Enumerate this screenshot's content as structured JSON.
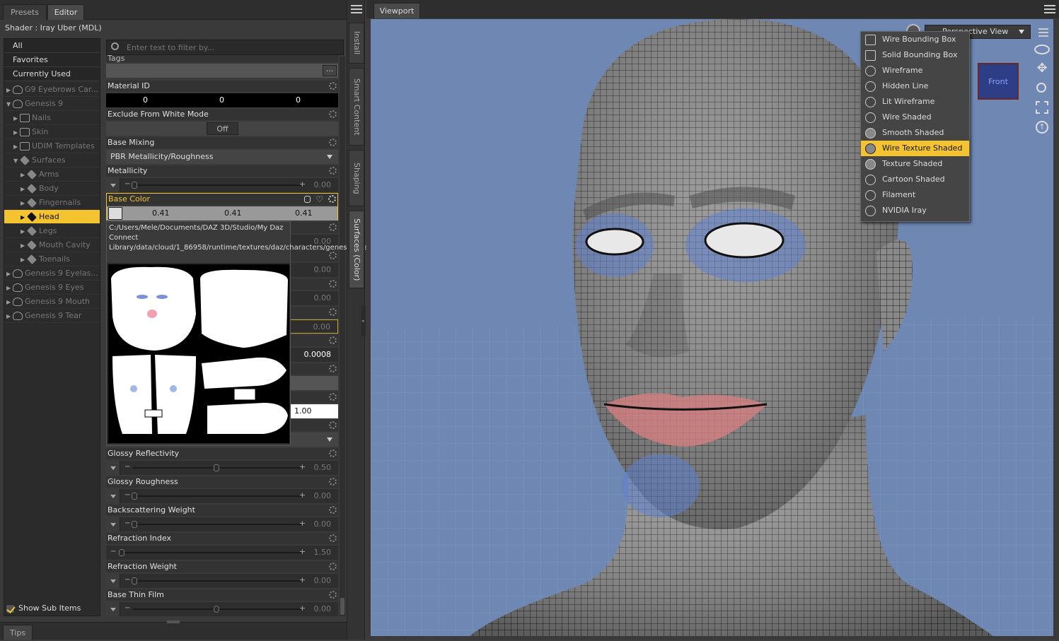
{
  "left_tabs": [
    "Presets",
    "Editor"
  ],
  "shader_line": "Shader :  Iray Uber (MDL)",
  "tree": {
    "categories": [
      "All",
      "Favorites",
      "Currently Used"
    ],
    "nodes": [
      {
        "label": "G9 Eyebrows Car...",
        "indent": 0,
        "arrow": "▶"
      },
      {
        "label": "Genesis 9",
        "indent": 0,
        "arrow": "▼"
      },
      {
        "label": "Nails",
        "indent": 1,
        "arrow": "▶"
      },
      {
        "label": "Skin",
        "indent": 1,
        "arrow": "▶"
      },
      {
        "label": "UDIM Templates",
        "indent": 1,
        "arrow": "▶"
      },
      {
        "label": "Surfaces",
        "indent": 1,
        "arrow": "▼"
      },
      {
        "label": "Arms",
        "indent": 2,
        "arrow": "▶"
      },
      {
        "label": "Body",
        "indent": 2,
        "arrow": "▶"
      },
      {
        "label": "Fingernails",
        "indent": 2,
        "arrow": "▶"
      },
      {
        "label": "Head",
        "indent": 2,
        "arrow": "▶",
        "selected": true
      },
      {
        "label": "Legs",
        "indent": 2,
        "arrow": "▶"
      },
      {
        "label": "Mouth Cavity",
        "indent": 2,
        "arrow": "▶"
      },
      {
        "label": "Toenails",
        "indent": 2,
        "arrow": "▶"
      },
      {
        "label": "Genesis 9 Eyelas...",
        "indent": 0,
        "arrow": "▶"
      },
      {
        "label": "Genesis 9 Eyes",
        "indent": 0,
        "arrow": "▶"
      },
      {
        "label": "Genesis 9 Mouth",
        "indent": 0,
        "arrow": "▶"
      },
      {
        "label": "Genesis 9 Tear",
        "indent": 0,
        "arrow": "▶"
      }
    ],
    "show_sub_items": "Show Sub Items"
  },
  "filter": {
    "placeholder": "Enter text to filter by..."
  },
  "props": {
    "tags_label": "Tags",
    "material_id_label": "Material ID",
    "material_id_values": [
      "0",
      "0",
      "0"
    ],
    "exclude_label": "Exclude From White Mode",
    "exclude_value": "Off",
    "base_mixing_label": "Base Mixing",
    "base_mixing_value": "PBR Metallicity/Roughness",
    "metallicity_label": "Metallicity",
    "metallicity_value": "0.00",
    "base_color_label": "Base Color",
    "base_color_values": [
      "0.41",
      "0.41",
      "0.41"
    ],
    "hidden_values": [
      "0.00",
      "0.00",
      "0.00",
      "0.00",
      "0.0008",
      "1.00"
    ],
    "glossy_reflectivity_label": "Glossy Reflectivity",
    "glossy_reflectivity_value": "0.50",
    "glossy_roughness_label": "Glossy Roughness",
    "glossy_roughness_value": "0.00",
    "backscattering_label": "Backscattering Weight",
    "backscattering_value": "0.00",
    "refraction_index_label": "Refraction Index",
    "refraction_index_value": "1.50",
    "refraction_weight_label": "Refraction Weight",
    "refraction_weight_value": "0.00",
    "base_thin_film_label": "Base Thin Film",
    "base_thin_film_value": "0.00"
  },
  "tooltip_path": "C:/Users/Mele/Documents/DAZ 3D/Studio/My Daz Connect Library/data/cloud/1_86958/runtime/textures/daz/characters/genesis9/base/devkit/genesis9_detail_atlas_m.jpg",
  "side_tabs": [
    "Install",
    "Smart Content",
    "Shaping",
    "Surfaces (Color)"
  ],
  "tips_tab": "Tips",
  "viewport_tab": "Viewport",
  "view_select": "Perspective View",
  "draw_style_menu": [
    {
      "label": "Wire Bounding Box"
    },
    {
      "label": "Solid Bounding Box"
    },
    {
      "label": "Wireframe"
    },
    {
      "label": "Hidden Line"
    },
    {
      "label": "Lit Wireframe"
    },
    {
      "label": "Wire Shaded"
    },
    {
      "label": "Smooth Shaded"
    },
    {
      "label": "Wire Texture Shaded",
      "selected": true
    },
    {
      "label": "Texture Shaded"
    },
    {
      "label": "Cartoon Shaded"
    },
    {
      "label": "Filament"
    },
    {
      "label": "NVIDIA Iray"
    }
  ],
  "cube_label": "Front",
  "colors": {
    "accent": "#f4c430",
    "viewport_bg": "#6e88b3"
  }
}
